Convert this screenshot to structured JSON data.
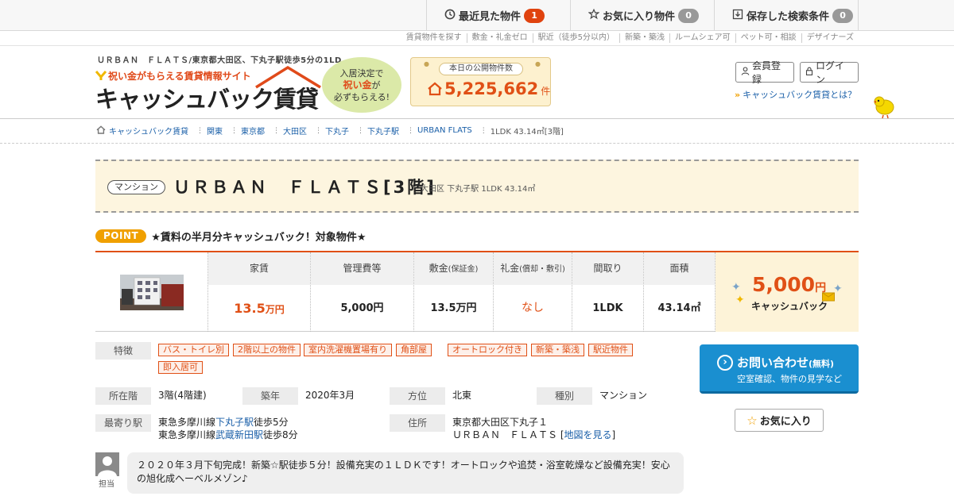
{
  "topbar": {
    "recent_label": "最近見た物件",
    "recent_count": "1",
    "favorites_label": "お気に入り物件",
    "favorites_count": "0",
    "saved_label": "保存した検索条件",
    "saved_count": "0"
  },
  "subnav": [
    "賃貸物件を探す",
    "敷金・礼金ゼロ",
    "駅近（徒歩5分以内）",
    "新築・築浅",
    "ルームシェア可",
    "ペット可・相談",
    "デザイナーズ"
  ],
  "header": {
    "page_heading": "ＵＲＢＡＮ　ＦＬＡＴＳ/東京都大田区、下丸子駅徒歩5分の1LD...",
    "logo_tagline": "祝い金がもらえる賃貸情報サイト",
    "logo_text": "キャッシュバック賃貸",
    "bubble_line1": "入居決定で",
    "bubble_line2": "祝い金",
    "bubble_line2_suffix": "が",
    "bubble_line3": "必ずもらえる!",
    "count_label": "本日の公開物件数",
    "count_value": "5,225,662",
    "count_unit": "件",
    "register_label": "会員登録",
    "login_label": "ログイン",
    "about_label": "キャッシュバック賃貸とは？"
  },
  "breadcrumbs": [
    "キャッシュバック賃貸",
    "関東",
    "東京都",
    "大田区",
    "下丸子",
    "下丸子駅",
    "URBAN FLATS",
    "1LDK 43.14㎡[3階]"
  ],
  "property": {
    "type": "マンション",
    "title": "ＵＲＢＡＮ　ＦＬＡＴＳ[3階]",
    "subtitle": "大田区 下丸子駅 1LDK 43.14㎡",
    "point_label": "POINT",
    "point_text": "★賃料の半月分キャッシュバック！対象物件★"
  },
  "spec": {
    "rent_h": "家賃",
    "rent_v": "13.5",
    "rent_unit": "万円",
    "mgmt_h": "管理費等",
    "mgmt_v": "5,000円",
    "deposit_h": "敷金",
    "deposit_h_sub": "(保証金)",
    "deposit_v": "13.5万円",
    "key_h": "礼金",
    "key_h_sub": "(償却・敷引)",
    "key_v": "なし",
    "layout_h": "間取り",
    "layout_v": "1LDK",
    "area_h": "面積",
    "area_v": "43.14㎡",
    "cashback_amount": "5,000",
    "cashback_unit": "円",
    "cashback_label": "キャッシュバック"
  },
  "details": {
    "features_label": "特徴",
    "features": [
      "バス・トイレ別",
      "2階以上の物件",
      "室内洗濯機置場有り",
      "角部屋",
      "オートロック付き",
      "新築・築浅",
      "駅近物件",
      "即入居可"
    ],
    "floor_label": "所在階",
    "floor_value": "3階(4階建)",
    "built_label": "築年",
    "built_value": "2020年3月",
    "direction_label": "方位",
    "direction_value": "北東",
    "kind_label": "種別",
    "kind_value": "マンション",
    "station_label": "最寄り駅",
    "station1_pre": "東急多摩川線",
    "station1_link": "下丸子駅",
    "station1_post": "徒歩5分",
    "station2_pre": "東急多摩川線",
    "station2_link": "武蔵新田駅",
    "station2_post": "徒歩8分",
    "address_label": "住所",
    "address_line1": "東京都大田区下丸子１",
    "address_line2": "ＵＲＢＡＮ　ＦＬＡＴＳ",
    "map_link": "地図を見る"
  },
  "actions": {
    "inquiry_label": "お問い合わせ",
    "inquiry_free": "(無料)",
    "inquiry_sub": "空室確認、物件の見学など",
    "favorite_label": "お気に入り"
  },
  "agent": {
    "label": "担当",
    "comment": "２０２０年３月下旬完成！新築☆駅徒歩５分！設備充実の１ＬＤＫです！オートロックや追焚・浴室乾燥など設備充実！安心の旭化成ヘーベルメゾン♪"
  },
  "colors": {
    "accent": "#e05016",
    "link": "#1a5fa8",
    "point": "#f0a000",
    "inquiry": "#1a8fd0"
  }
}
